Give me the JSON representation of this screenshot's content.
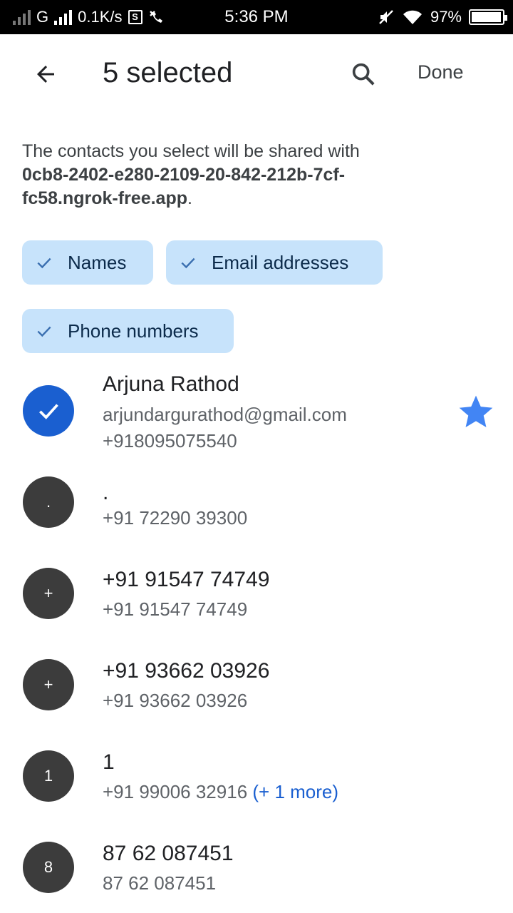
{
  "status_bar": {
    "network": "G",
    "speed": "0.1K/s",
    "time": "5:36 PM",
    "battery": "97%",
    "battery_level": 0.97,
    "s_badge": "S"
  },
  "header": {
    "title": "5 selected",
    "done_label": "Done"
  },
  "info": {
    "prefix": "The contacts you select will be shared with",
    "host": "0cb8-2402-e280-2109-20-842-212b-7cf-fc58.ngrok-free.app",
    "suffix": "."
  },
  "chips": [
    {
      "label": "Names"
    },
    {
      "label": "Email addresses"
    },
    {
      "label": "Phone numbers"
    }
  ],
  "contacts": [
    {
      "name": "Arjuna Rathod",
      "email": "arjundargurathod@gmail.com",
      "phone": "+918095075540",
      "selected": true,
      "starred": true
    },
    {
      "initial": ".",
      "name": ".",
      "phone": "+91 72290 39300"
    },
    {
      "initial": "+",
      "name": "+91 91547 74749",
      "phone": "+91 91547 74749"
    },
    {
      "initial": "+",
      "name": "+91 93662 03926",
      "phone": "+91 93662 03926"
    },
    {
      "initial": "1",
      "name": "1",
      "phone": "+91 99006 32916",
      "more": "(+ 1 more)"
    },
    {
      "initial": "8",
      "name": "87 62 087451",
      "phone": "87 62 087451"
    }
  ],
  "colors": {
    "accent": "#1a5fd0",
    "chip_bg": "#c7e3fb",
    "avatar_bg": "#3c3c3c",
    "star": "#4285f4"
  }
}
